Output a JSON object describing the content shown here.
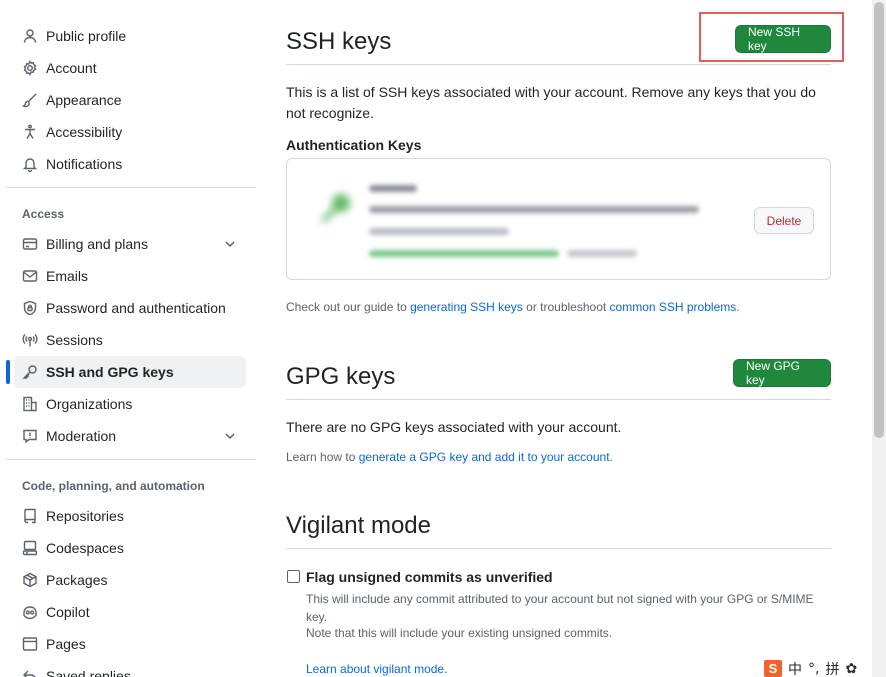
{
  "sidebar": {
    "top_items": [
      {
        "label": "Public profile",
        "icon": "person-icon"
      },
      {
        "label": "Account",
        "icon": "gear-icon"
      },
      {
        "label": "Appearance",
        "icon": "paintbrush-icon"
      },
      {
        "label": "Accessibility",
        "icon": "accessibility-icon"
      },
      {
        "label": "Notifications",
        "icon": "bell-icon"
      }
    ],
    "access_title": "Access",
    "access_items": [
      {
        "label": "Billing and plans",
        "icon": "credit-card-icon"
      },
      {
        "label": "Emails",
        "icon": "mail-icon"
      },
      {
        "label": "Password and authentication",
        "icon": "shield-lock-icon"
      },
      {
        "label": "Sessions",
        "icon": "broadcast-icon"
      },
      {
        "label": "SSH and GPG keys",
        "icon": "key-icon"
      },
      {
        "label": "Organizations",
        "icon": "organization-icon"
      },
      {
        "label": "Moderation",
        "icon": "report-icon"
      }
    ],
    "code_title": "Code, planning, and automation",
    "code_items": [
      {
        "label": "Repositories",
        "icon": "repo-icon"
      },
      {
        "label": "Codespaces",
        "icon": "codespaces-icon"
      },
      {
        "label": "Packages",
        "icon": "package-icon"
      },
      {
        "label": "Copilot",
        "icon": "copilot-icon"
      },
      {
        "label": "Pages",
        "icon": "browser-icon"
      },
      {
        "label": "Saved replies",
        "icon": "reply-icon"
      }
    ]
  },
  "ssh": {
    "title": "SSH keys",
    "new_button": "New SSH key",
    "description": "This is a list of SSH keys associated with your account. Remove any keys that you do not recognize.",
    "auth_heading": "Authentication Keys",
    "delete_button": "Delete",
    "guide_prefix": "Check out our guide to ",
    "guide_link1": "generating SSH keys",
    "guide_middle": " or troubleshoot ",
    "guide_link2": "common SSH problems",
    "guide_suffix": "."
  },
  "gpg": {
    "title": "GPG keys",
    "new_button": "New GPG key",
    "empty_text": "There are no GPG keys associated with your account.",
    "learn_prefix": "Learn how to ",
    "learn_link": "generate a GPG key and add it to your account",
    "learn_suffix": "."
  },
  "vigilant": {
    "title": "Vigilant mode",
    "checkbox_label": "Flag unsigned commits as unverified",
    "desc1": "This will include any commit attributed to your account but not signed with your GPG or S/MIME key.",
    "desc2": "Note that this will include your existing unsigned commits.",
    "learn_link": "Learn about vigilant mode."
  },
  "ime": {
    "logo": "S",
    "lang": "中",
    "punct": "°,",
    "pinyin": "拼"
  },
  "colors": {
    "primary_button": "#1f883d",
    "link": "#0969da",
    "danger": "#d1242f",
    "active_bar": "#0969da",
    "annotation_box": "#e25d5d"
  }
}
